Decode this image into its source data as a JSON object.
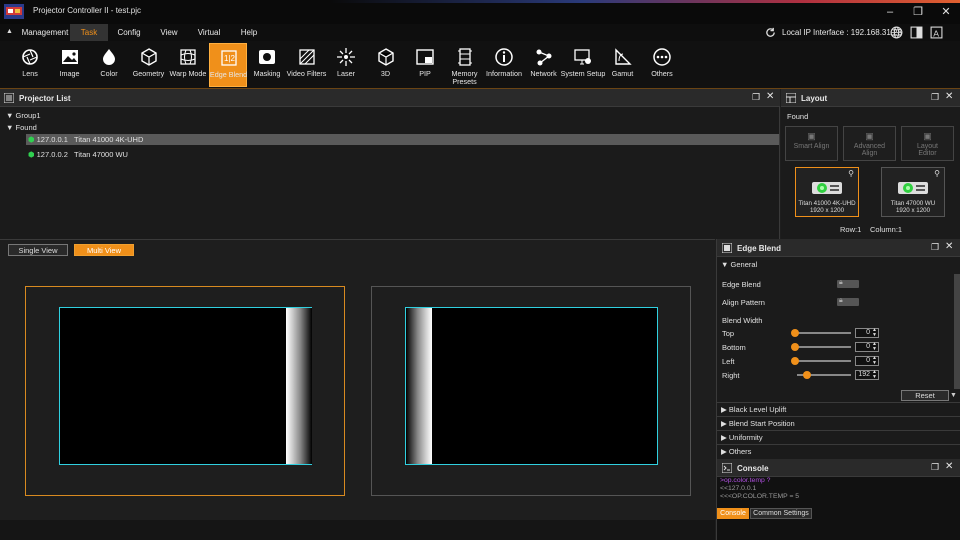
{
  "titlebar": {
    "title": "Projector Controller II - test.pjc"
  },
  "menu": {
    "items": [
      "Management",
      "Task",
      "Config",
      "View",
      "Virtual",
      "Help"
    ],
    "ip_label": "Local IP Interface : 192.168.31.23"
  },
  "ribbon": {
    "tools": [
      {
        "label": "Lens",
        "icon": "lens-icon"
      },
      {
        "label": "Image",
        "icon": "image-icon"
      },
      {
        "label": "Color",
        "icon": "color-icon"
      },
      {
        "label": "Geometry",
        "icon": "geometry-icon"
      },
      {
        "label": "Warp Mode",
        "icon": "warp-icon"
      },
      {
        "label": "Edge Blend",
        "icon": "edge-blend-icon"
      },
      {
        "label": "Masking",
        "icon": "masking-icon"
      },
      {
        "label": "Video Filters",
        "icon": "video-filters-icon"
      },
      {
        "label": "Laser",
        "icon": "laser-icon"
      },
      {
        "label": "3D",
        "icon": "cube-icon"
      },
      {
        "label": "PIP",
        "icon": "pip-icon"
      },
      {
        "label": "Memory Presets",
        "icon": "memory-icon"
      },
      {
        "label": "Information",
        "icon": "info-icon"
      },
      {
        "label": "Network",
        "icon": "network-icon"
      },
      {
        "label": "System Setup",
        "icon": "system-icon"
      },
      {
        "label": "Gamut",
        "icon": "gamut-icon"
      },
      {
        "label": "Others",
        "icon": "others-icon"
      }
    ],
    "active": "Edge Blend"
  },
  "projector_list": {
    "title": "Projector List",
    "group": "Group1",
    "found": "Found",
    "items": [
      {
        "ip": "127.0.0.1",
        "model": "Titan 41000 4K-UHD"
      },
      {
        "ip": "127.0.0.2",
        "model": "Titan 47000 WU"
      }
    ]
  },
  "layout": {
    "title": "Layout",
    "found": "Found",
    "buttons": [
      "Smart Align",
      "Advanced Align",
      "Layout Editor"
    ],
    "cards": [
      {
        "model": "Titan 41000 4K-UHD",
        "res": "1920 x 1200"
      },
      {
        "model": "Titan 47000 WU",
        "res": "1920 x 1200"
      }
    ],
    "row": "Row:1",
    "column": "Column:1"
  },
  "view": {
    "tabs": [
      "Single View",
      "Multi View"
    ],
    "active": "Multi View"
  },
  "edge_blend": {
    "title": "Edge Blend",
    "general": "General",
    "edge_blend_label": "Edge Blend",
    "align_pattern_label": "Align Pattern",
    "blend_width": "Blend Width",
    "sliders": [
      {
        "label": "Top",
        "value": "0"
      },
      {
        "label": "Bottom",
        "value": "0"
      },
      {
        "label": "Left",
        "value": "0"
      },
      {
        "label": "Right",
        "value": "192"
      }
    ],
    "reset": "Reset",
    "sections": [
      "Black Level Uplift",
      "Blend Start Position",
      "Uniformity",
      "Others"
    ]
  },
  "console": {
    "title": "Console",
    "lines": [
      ">op.color.temp ?",
      "<<127.0.0.1",
      "<<<OP.COLOR.TEMP = 5"
    ],
    "tabs": [
      "Console",
      "Common Settings"
    ]
  }
}
